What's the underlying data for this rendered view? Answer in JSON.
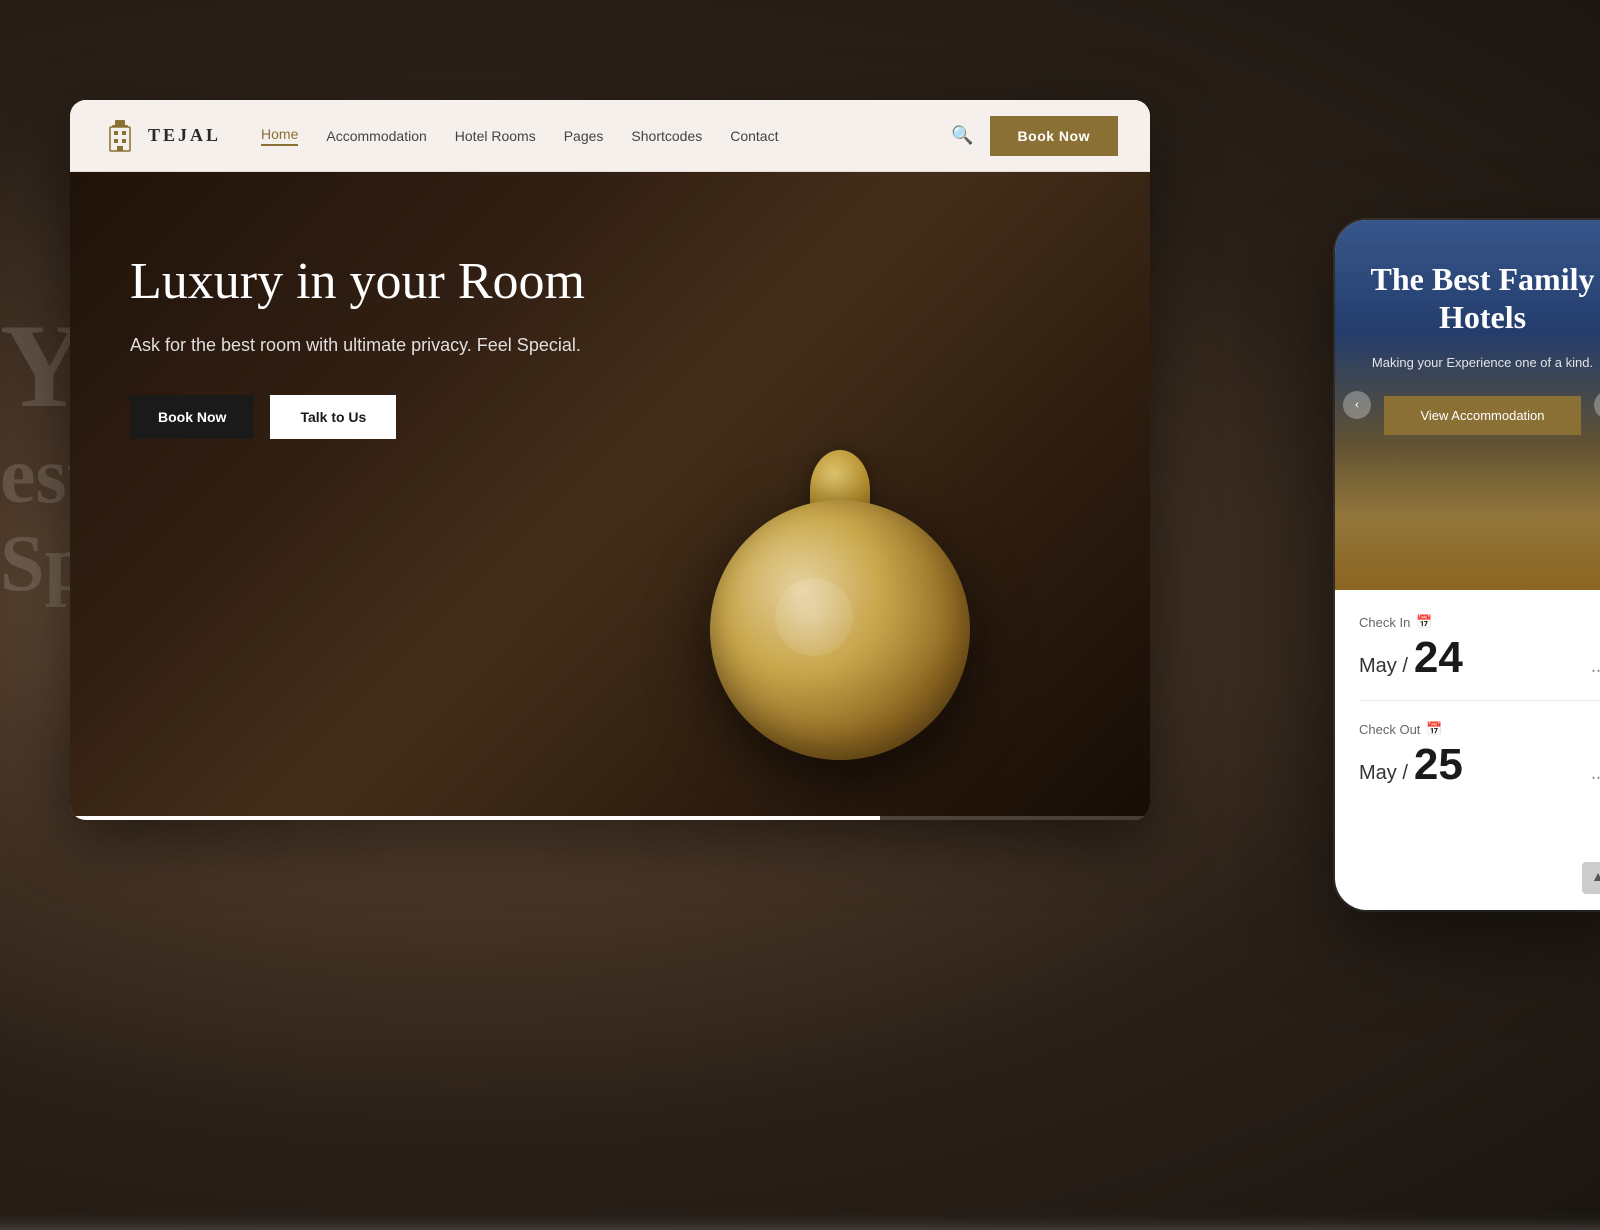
{
  "background": {
    "hint_text_1": "Y i",
    "hint_text_2": "est",
    "hint_text_3": "Spe"
  },
  "desktop": {
    "navbar": {
      "logo_icon_label": "building-icon",
      "logo_text": "TEJAL",
      "links": [
        {
          "label": "Home",
          "active": true
        },
        {
          "label": "Accommodation",
          "active": false
        },
        {
          "label": "Hotel Rooms",
          "active": false
        },
        {
          "label": "Pages",
          "active": false
        },
        {
          "label": "Shortcodes",
          "active": false
        },
        {
          "label": "Contact",
          "active": false
        }
      ],
      "book_now_label": "Book Now"
    },
    "hero": {
      "title": "Luxury in your Room",
      "subtitle": "Ask for the best room with ultimate privacy. Feel Special.",
      "btn_book_label": "Book Now",
      "btn_talk_label": "Talk to Us"
    }
  },
  "mobile": {
    "hero": {
      "title": "The Best Family Hotels",
      "subtitle": "Making your Experience one of a kind.",
      "view_btn_label": "View Accommodation",
      "nav_prev": "‹",
      "nav_next": "›"
    },
    "booking": {
      "checkin_label": "Check In",
      "checkin_month": "May /",
      "checkin_day": "24",
      "checkin_more": "...",
      "checkout_label": "Check Out",
      "checkout_month": "May /",
      "checkout_day": "25",
      "checkout_more": "...",
      "calendar_icon": "📅"
    },
    "scroll_top_icon": "▲"
  }
}
